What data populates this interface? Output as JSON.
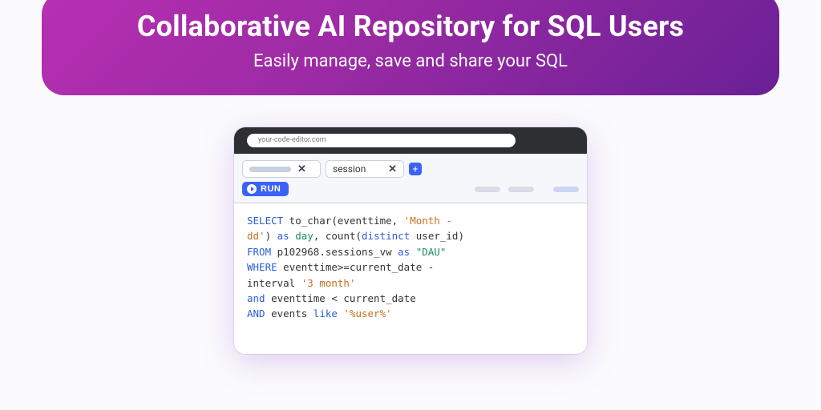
{
  "hero": {
    "title": "Collaborative AI Repository for SQL Users",
    "subtitle": "Easily manage, save and share your SQL"
  },
  "browser": {
    "url": "your-code-editor.com"
  },
  "tabs": {
    "tab1_label": "",
    "tab2_label": "session",
    "add_label": "+"
  },
  "toolbar": {
    "run_label": "RUN"
  },
  "sql": {
    "line1_kw": "SELECT",
    "line1_rest": " to_char(eventtime, ",
    "line1_str": "'Month -",
    "line2_str": "dd'",
    "line2_mid": ") ",
    "line2_kw": "as",
    "line2_alias": " day",
    "line2_mid2": ", count(",
    "line2_kw2": "distinct",
    "line2_rest": " user_id)",
    "line3_kw": "FROM",
    "line3_rest": " p102968.sessions_vw ",
    "line3_kw2": "as",
    "line3_alias": " \"DAU\"",
    "line4_kw": "WHERE",
    "line4_rest": " eventtime>=current_date -",
    "line5_a": "interval ",
    "line5_str": "'3 month'",
    "line6_kw": "and",
    "line6_rest": " eventtime < current_date",
    "line7_kw": "AND",
    "line7_rest": " events ",
    "line7_kw2": "like",
    "line7_str": " '%user%'"
  }
}
